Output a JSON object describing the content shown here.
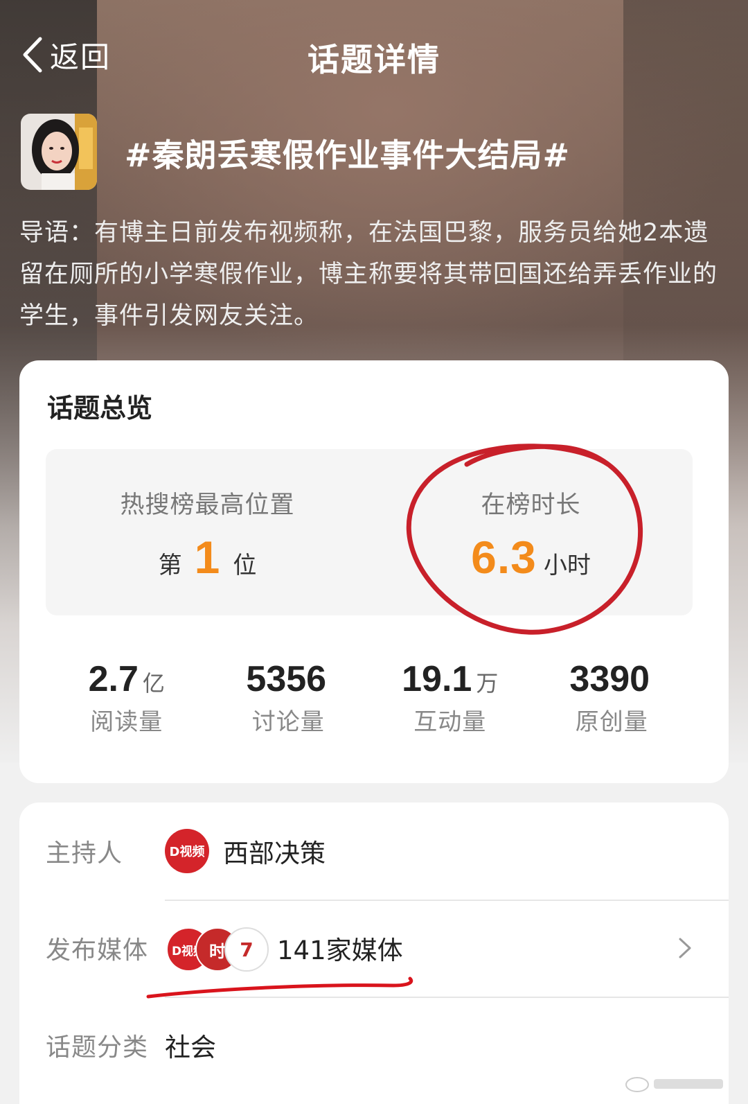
{
  "nav": {
    "back_label": "返回",
    "title": "话题详情"
  },
  "topic": {
    "name": "#秦朗丢寒假作业事件大结局#",
    "intro": "导语：有博主日前发布视频称，在法国巴黎，服务员给她2本遗留在厕所的小学寒假作业，博主称要将其带回国还给弄丢作业的学生，事件引发网友关注。"
  },
  "overview": {
    "title": "话题总览",
    "peak_rank": {
      "label": "热搜榜最高位置",
      "prefix": "第",
      "value": "1",
      "suffix": "位"
    },
    "duration": {
      "label": "在榜时长",
      "value": "6.3",
      "unit": "小时"
    },
    "stats": [
      {
        "value": "2.7",
        "unit": "亿",
        "label": "阅读量"
      },
      {
        "value": "5356",
        "unit": "",
        "label": "讨论量"
      },
      {
        "value": "19.1",
        "unit": "万",
        "label": "互动量"
      },
      {
        "value": "3390",
        "unit": "",
        "label": "原创量"
      }
    ]
  },
  "info": {
    "host_label": "主持人",
    "host_logo_text": "D视频",
    "host_name": "西部决策",
    "media_label": "发布媒体",
    "media_logos": [
      "D视频",
      "时",
      "7"
    ],
    "media_count": "141家媒体",
    "category_label": "话题分类",
    "category_value": "社会"
  },
  "colors": {
    "accent": "#f38b1b",
    "annotation_red": "#c8202a",
    "logo_red": "#d4242a"
  }
}
